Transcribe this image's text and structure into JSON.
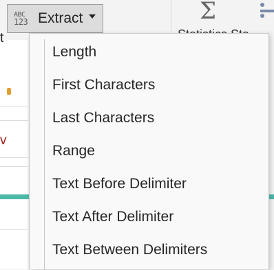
{
  "ribbon": {
    "extract_button": {
      "icon_top": "ABC",
      "icon_bottom": "123",
      "label": "Extract"
    },
    "statistics_label": "Statistics Sta",
    "left_fragments": {
      "line1": "t",
      "line2": "v"
    }
  },
  "menu": {
    "items": [
      {
        "label": "Length"
      },
      {
        "label": "First Characters"
      },
      {
        "label": "Last Characters"
      },
      {
        "label": "Range"
      },
      {
        "label": "Text Before Delimiter"
      },
      {
        "label": "Text After Delimiter"
      },
      {
        "label": "Text Between Delimiters"
      }
    ]
  },
  "colors": {
    "accent_teal": "#4cb8a8",
    "menu_bg": "#f9f9f9",
    "text": "#262626"
  }
}
